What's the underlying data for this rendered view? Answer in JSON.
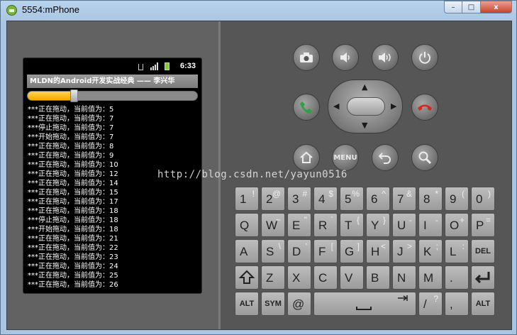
{
  "window": {
    "title": "5554:mPhone",
    "minimize": "–",
    "maximize": "□",
    "close": "x"
  },
  "status": {
    "time": "6:33"
  },
  "app": {
    "title": "MLDN的Android开发实战经典 —— 李兴华"
  },
  "seekbar": {
    "progress_fraction": 0.26
  },
  "log_lines": [
    "***正在拖动，当前值为：5",
    "***正在拖动，当前值为：7",
    "***停止拖动，当前值为：7",
    "***开始拖动，当前值为：7",
    "***正在拖动，当前值为：8",
    "***正在拖动，当前值为：9",
    "***正在拖动，当前值为：10",
    "***正在拖动，当前值为：12",
    "***正在拖动，当前值为：14",
    "***正在拖动，当前值为：15",
    "***正在拖动，当前值为：17",
    "***正在拖动，当前值为：18",
    "***停止拖动，当前值为：18",
    "***开始拖动，当前值为：18",
    "***正在拖动，当前值为：21",
    "***正在拖动，当前值为：22",
    "***正在拖动，当前值为：23",
    "***正在拖动，当前值为：24",
    "***正在拖动，当前值为：25",
    "***正在拖动，当前值为：26"
  ],
  "controls": {
    "camera_icon": "camera-icon",
    "volume_down_icon": "volume-down-icon",
    "volume_up_icon": "volume-up-icon",
    "power_icon": "power-icon",
    "call_icon": "call-icon",
    "end_call_icon": "end-call-icon",
    "home_icon": "home-icon",
    "menu_label": "MENU",
    "back_icon": "back-icon",
    "search_icon": "search-icon"
  },
  "keyboard": {
    "row1": [
      [
        "1",
        "!"
      ],
      [
        "2",
        "@"
      ],
      [
        "3",
        "#"
      ],
      [
        "4",
        "$"
      ],
      [
        "5",
        "%"
      ],
      [
        "6",
        "^"
      ],
      [
        "7",
        "&"
      ],
      [
        "8",
        "*"
      ],
      [
        "9",
        "("
      ],
      [
        "0",
        ")"
      ]
    ],
    "row2": [
      [
        "Q",
        ""
      ],
      [
        "W",
        "~"
      ],
      [
        "E",
        "\""
      ],
      [
        "R",
        "`"
      ],
      [
        "T",
        "{"
      ],
      [
        "Y",
        "}"
      ],
      [
        "U",
        "-"
      ],
      [
        "I",
        "-"
      ],
      [
        "O",
        "+"
      ],
      [
        "P",
        "="
      ]
    ],
    "row3": [
      [
        "A",
        ""
      ],
      [
        "S",
        "\\"
      ],
      [
        "D",
        "'"
      ],
      [
        "F",
        "["
      ],
      [
        "G",
        "]"
      ],
      [
        "H",
        "<"
      ],
      [
        "J",
        ">"
      ],
      [
        "K",
        ";"
      ],
      [
        "L",
        ":"
      ]
    ],
    "del_label": "DEL",
    "row4": [
      [
        "Z",
        ""
      ],
      [
        "X",
        ""
      ],
      [
        "C",
        ""
      ],
      [
        "V",
        ""
      ],
      [
        "B",
        ""
      ],
      [
        "N",
        ""
      ],
      [
        "M",
        ""
      ],
      [
        ".",
        ""
      ]
    ],
    "alt_label": "ALT",
    "sym_label": "SYM",
    "at_label": "@",
    "slash_label": "/",
    "question_label": "?",
    "comma_label": ","
  },
  "watermark": "http://blog.csdn.net/yayun0516"
}
